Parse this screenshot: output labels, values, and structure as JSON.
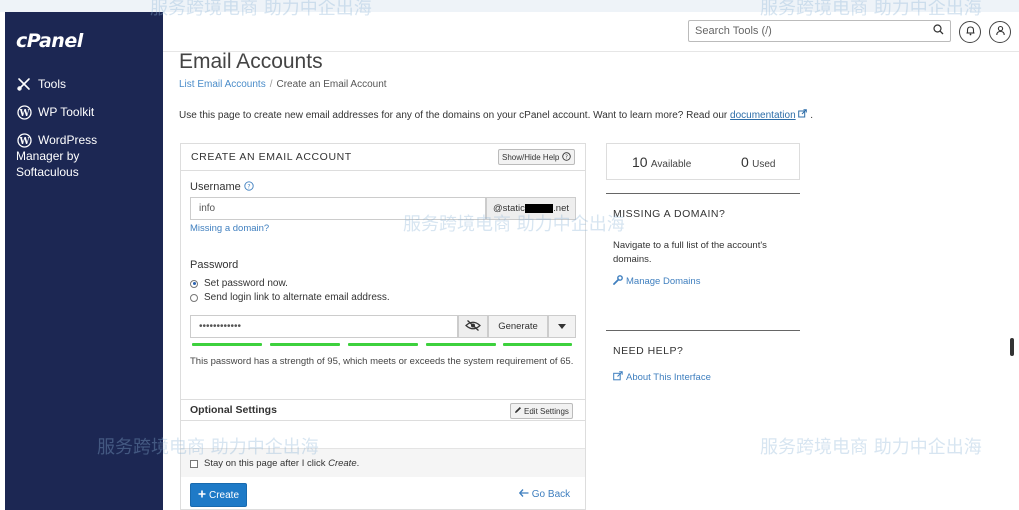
{
  "sidebar": {
    "logo": "cPanel",
    "items": [
      {
        "label": "Tools"
      },
      {
        "label": "WP Toolkit"
      },
      {
        "label": "WordPress",
        "label2": "Manager by",
        "label3": "Softaculous"
      }
    ]
  },
  "header": {
    "search_placeholder": "Search Tools (/)"
  },
  "page": {
    "title": "Email Accounts",
    "breadcrumb": {
      "parent": "List Email Accounts",
      "current": "Create an Email Account"
    },
    "intro_text": "Use this page to create new email addresses for any of the domains on your cPanel account. Want to learn more? Read our",
    "intro_link": "documentation",
    "intro_end": "."
  },
  "form": {
    "heading": "CREATE AN EMAIL ACCOUNT",
    "help_toggle": "Show/Hide Help",
    "username_label": "Username",
    "username_value": "info",
    "domain_prefix": "@static",
    "domain_suffix": ".net",
    "missing_domain_link": "Missing a domain?",
    "password_label": "Password",
    "radio_set_now": "Set password now.",
    "radio_send_link": "Send login link to alternate email address.",
    "password_value": "••••••••••••",
    "generate_label": "Generate",
    "strength_note": "This password has a strength of 95, which meets or exceeds the system requirement of 65.",
    "password_strength": 95,
    "optional_label": "Optional Settings",
    "edit_settings_label": "Edit Settings",
    "stay_label": "Stay on this page after I click",
    "stay_label_em": "Create",
    "stay_label_end": ".",
    "create_label": "Create",
    "back_label": "Go Back"
  },
  "stats": {
    "available_count": "10",
    "available_label": "Available",
    "used_count": "0",
    "used_label": "Used"
  },
  "missing_domain": {
    "heading": "MISSING A DOMAIN?",
    "text": "Navigate to a full list of the account's domains.",
    "link": "Manage Domains"
  },
  "need_help": {
    "heading": "NEED HELP?",
    "link": "About This Interface"
  },
  "watermark": {
    "text": "服务跨境电商 助力中企出海"
  },
  "colors": {
    "sidebar_bg": "#1c2753",
    "primary": "#1e7ac7",
    "link": "#3f7fbf",
    "strength_bar": "#3dd13d"
  }
}
